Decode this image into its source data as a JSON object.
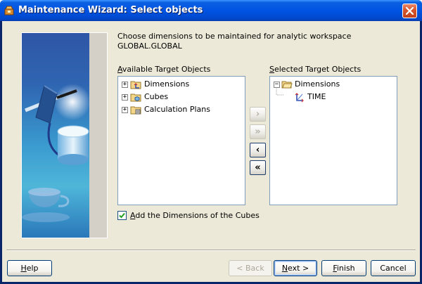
{
  "window": {
    "title": "Maintenance Wizard: Select objects"
  },
  "instructions": {
    "line1": "Choose dimensions to be maintained for analytic workspace",
    "line2": "GLOBAL.GLOBAL"
  },
  "available": {
    "label_first": "A",
    "label_rest": "vailable Target Objects",
    "items": [
      {
        "label": "Dimensions",
        "icon": "folder-dimension-icon"
      },
      {
        "label": "Cubes",
        "icon": "folder-cube-icon"
      },
      {
        "label": "Calculation Plans",
        "icon": "folder-calc-plan-icon"
      }
    ]
  },
  "selected": {
    "label_first": "S",
    "label_rest": "elected Target Objects",
    "root": "Dimensions",
    "children": [
      "TIME"
    ]
  },
  "shuttle": {
    "move_one": "›",
    "move_all": "»",
    "remove_one": "‹",
    "remove_all": "«"
  },
  "checkbox": {
    "checked": true,
    "label_first": "A",
    "label_rest": "dd the Dimensions of the Cubes"
  },
  "buttons": {
    "help_first": "H",
    "help_rest": "elp",
    "back": "< Back",
    "back_underline": "B",
    "next_first": "N",
    "next_rest": "ext >",
    "finish_first": "F",
    "finish_rest": "inish",
    "cancel": "Cancel"
  },
  "colors": {
    "title_bar": "#0054e3",
    "dialog_bg": "#ece9d8",
    "close_button": "#d9572e"
  }
}
